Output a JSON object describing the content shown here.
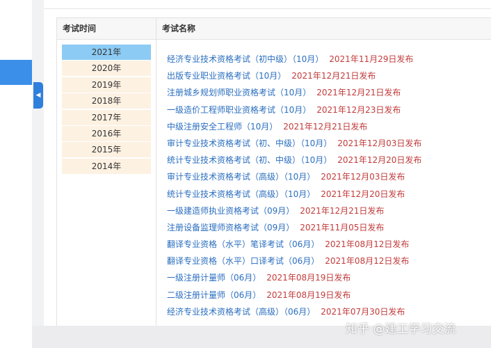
{
  "table": {
    "col_time_header": "考试时间",
    "col_name_header": "考试名称"
  },
  "years": [
    "2021年",
    "2020年",
    "2019年",
    "2018年",
    "2017年",
    "2016年",
    "2015年",
    "2014年"
  ],
  "selected_year": "2021年",
  "exams": [
    {
      "name": "经济专业技术资格考试（初中级）（10月）",
      "date": "2021年11月29日发布"
    },
    {
      "name": "出版专业职业资格考试（10月）",
      "date": "2021年12月21日发布"
    },
    {
      "name": "注册城乡规划师职业资格考试（10月）",
      "date": "2021年12月21日发布"
    },
    {
      "name": "一级造价工程师职业资格考试（10月）",
      "date": "2021年12月23日发布"
    },
    {
      "name": "中级注册安全工程师（10月）",
      "date": "2021年12月21日发布"
    },
    {
      "name": "审计专业技术资格考试（初、中级）（10月）",
      "date": "2021年12月03日发布"
    },
    {
      "name": "统计专业技术资格考试（初、中级）（10月）",
      "date": "2021年12月20日发布"
    },
    {
      "name": "审计专业技术资格考试（高级）（10月）",
      "date": "2021年12月03日发布"
    },
    {
      "name": "统计专业技术资格考试（高级）（10月）",
      "date": "2021年12月20日发布"
    },
    {
      "name": "一级建造师执业资格考试（09月）",
      "date": "2021年12月21日发布"
    },
    {
      "name": "注册设备监理师资格考试（09月）",
      "date": "2021年11月05日发布"
    },
    {
      "name": "翻译专业资格（水平）笔译考试（06月）",
      "date": "2021年08月12日发布"
    },
    {
      "name": "翻译专业资格（水平）口译考试（06月）",
      "date": "2021年08月12日发布"
    },
    {
      "name": "一级注册计量师（06月）",
      "date": "2021年08月19日发布"
    },
    {
      "name": "二级注册计量师（06月）",
      "date": "2021年08月19日发布"
    },
    {
      "name": "经济专业技术资格考试（高级）（06月）",
      "date": "2021年07月30日发布"
    }
  ],
  "watermark": "知乎 @建工学习交流",
  "colors": {
    "selected_year_bg": "#8ccbf4",
    "year_bg": "#fdf1e2",
    "link": "#2a6ebf",
    "date": "#c23b3b",
    "accent": "#3b8fe8"
  },
  "icons": {
    "collapse": "chevron-left-icon"
  }
}
